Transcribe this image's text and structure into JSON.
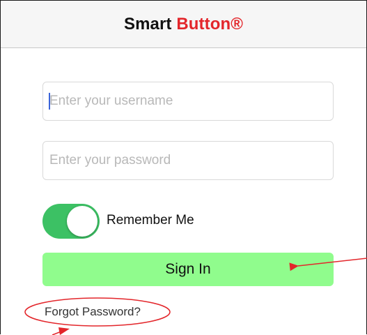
{
  "header": {
    "title_part1": "Smart",
    "title_part2": "Button®"
  },
  "form": {
    "username_placeholder": "Enter your username",
    "password_placeholder": "Enter your password",
    "remember_me": {
      "label": "Remember Me",
      "checked": true
    },
    "signin_label": "Sign In",
    "forgot_label": "Forgot Password?"
  },
  "colors": {
    "brand_red": "#e3262b",
    "toggle_on": "#3cc164",
    "signin_bg": "#90fc8d",
    "annotation_red": "#e3262b"
  }
}
